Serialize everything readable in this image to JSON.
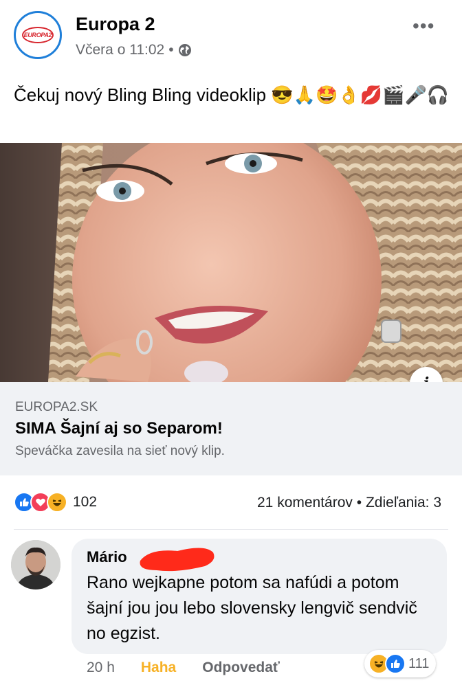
{
  "post": {
    "page_name": "Europa 2",
    "logo_text": "EUROPA2",
    "timestamp": "Včera o 11:02",
    "separator": "•",
    "visibility_icon": "globe-icon",
    "more_icon": "more-icon",
    "more_label": "•••",
    "text": "Čekuj nový Bling Bling videoklip 😎🙏🤩👌💋🎬🎤🎧"
  },
  "link_preview": {
    "domain": "EUROPA2.SK",
    "title": "SIMA Šajní aj so Separom!",
    "description": "Speváčka zavesila na sieť nový klip.",
    "info_label": "i"
  },
  "stats": {
    "reaction_icons": [
      "like-icon",
      "love-icon",
      "haha-icon"
    ],
    "reaction_count": "102",
    "comments": "21 komentárov",
    "separator": "•",
    "shares": "Zdieľania: 3"
  },
  "comment": {
    "author": "Mário",
    "text": "Rano wejkapne potom sa nafúdi a potom šajní jou jou lebo slovensky lengvič sendvič no egzist.",
    "time": "20 h",
    "reaction_label": "Haha",
    "reply_label": "Odpovedať",
    "reaction_icons": [
      "haha-icon",
      "like-icon"
    ],
    "reaction_count": "111"
  },
  "colors": {
    "like": "#1877f2",
    "love": "#f33e58",
    "haha": "#f7b125",
    "brand_red": "#d7262e",
    "brand_blue": "#1f7fd9"
  }
}
